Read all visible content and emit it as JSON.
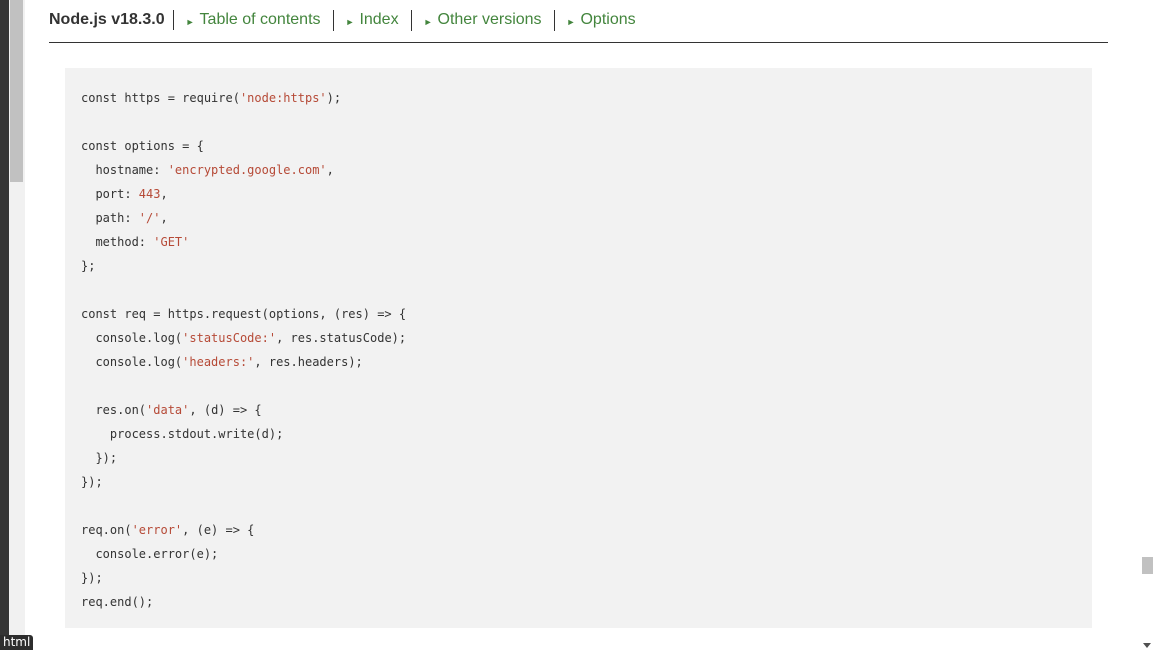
{
  "header": {
    "title": "Node.js v18.3.0",
    "nav": [
      {
        "label": "Table of contents"
      },
      {
        "label": "Index"
      },
      {
        "label": "Other versions"
      },
      {
        "label": "Options"
      }
    ]
  },
  "status_tooltip": "html",
  "code": {
    "lines": [
      [
        {
          "t": "const https = require(",
          "c": "kw"
        },
        {
          "t": "'node:https'",
          "c": "str"
        },
        {
          "t": ");",
          "c": "kw"
        }
      ],
      [],
      [
        {
          "t": "const options = {",
          "c": "kw"
        }
      ],
      [
        {
          "t": "  hostname: ",
          "c": "kw"
        },
        {
          "t": "'encrypted.google.com'",
          "c": "str"
        },
        {
          "t": ",",
          "c": "kw"
        }
      ],
      [
        {
          "t": "  port: ",
          "c": "kw"
        },
        {
          "t": "443",
          "c": "num"
        },
        {
          "t": ",",
          "c": "kw"
        }
      ],
      [
        {
          "t": "  path: ",
          "c": "kw"
        },
        {
          "t": "'/'",
          "c": "str"
        },
        {
          "t": ",",
          "c": "kw"
        }
      ],
      [
        {
          "t": "  method: ",
          "c": "kw"
        },
        {
          "t": "'GET'",
          "c": "str"
        }
      ],
      [
        {
          "t": "};",
          "c": "kw"
        }
      ],
      [],
      [
        {
          "t": "const req = https.request(options, (res) => {",
          "c": "kw"
        }
      ],
      [
        {
          "t": "  console.log(",
          "c": "kw"
        },
        {
          "t": "'statusCode:'",
          "c": "str"
        },
        {
          "t": ", res.statusCode);",
          "c": "kw"
        }
      ],
      [
        {
          "t": "  console.log(",
          "c": "kw"
        },
        {
          "t": "'headers:'",
          "c": "str"
        },
        {
          "t": ", res.headers);",
          "c": "kw"
        }
      ],
      [],
      [
        {
          "t": "  res.on(",
          "c": "kw"
        },
        {
          "t": "'data'",
          "c": "str"
        },
        {
          "t": ", (d) => {",
          "c": "kw"
        }
      ],
      [
        {
          "t": "    process.stdout.write(d);",
          "c": "kw"
        }
      ],
      [
        {
          "t": "  });",
          "c": "kw"
        }
      ],
      [
        {
          "t": "});",
          "c": "kw"
        }
      ],
      [],
      [
        {
          "t": "req.on(",
          "c": "kw"
        },
        {
          "t": "'error'",
          "c": "str"
        },
        {
          "t": ", (e) => {",
          "c": "kw"
        }
      ],
      [
        {
          "t": "  console.error(e);",
          "c": "kw"
        }
      ],
      [
        {
          "t": "});",
          "c": "kw"
        }
      ],
      [
        {
          "t": "req.end();",
          "c": "kw"
        }
      ]
    ]
  },
  "colors": {
    "nav_link": "#43853d",
    "code_background": "#f2f2f2",
    "string": "#b64a37"
  }
}
